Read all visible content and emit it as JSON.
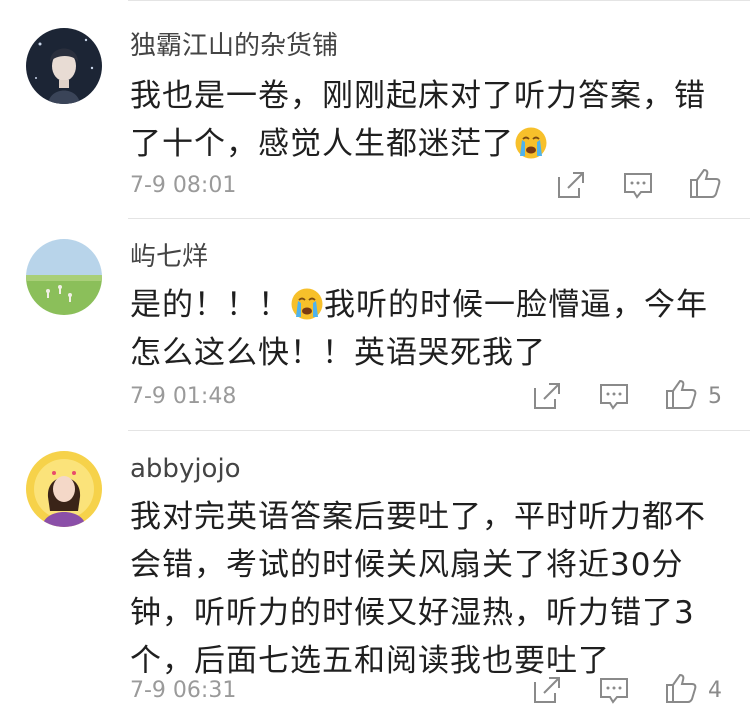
{
  "comments": [
    {
      "username": "独霸江山的杂货铺",
      "text_parts": [
        "我也是一卷，刚刚起床对了听力答案，错了十个，感觉人生都迷茫了",
        ""
      ],
      "emoji": "crying-face",
      "timestamp": "7-9 08:01",
      "likes": "",
      "avatar": "user-photo-dark-portrait"
    },
    {
      "username": "屿七烊",
      "text_parts": [
        "是的！！！",
        "我听的时候一脸懵逼，今年怎么这么快！！英语哭死我了"
      ],
      "emoji": "crying-face",
      "timestamp": "7-9 01:48",
      "likes": "5",
      "avatar": "landscape-grass-field"
    },
    {
      "username": "abbyjojo",
      "text_parts": [
        "我对完英语答案后要吐了，平时听力都不会错，考试的时候关风扇关了将近30分钟，听听力的时候又好湿热，听力错了3个，后面七选五和阅读我也要吐了"
      ],
      "emoji": "",
      "timestamp": "7-9 06:31",
      "likes": "4",
      "avatar": "girl-illustration-yellow"
    }
  ],
  "icons": {
    "share": "share-icon",
    "comment": "comment-icon",
    "like": "thumbs-up-icon"
  },
  "colors": {
    "text": "#1f1f1f",
    "username": "#444444",
    "meta": "#9a9a9a",
    "divider": "#e4e4e4",
    "emoji_face": "#f7c02b"
  }
}
